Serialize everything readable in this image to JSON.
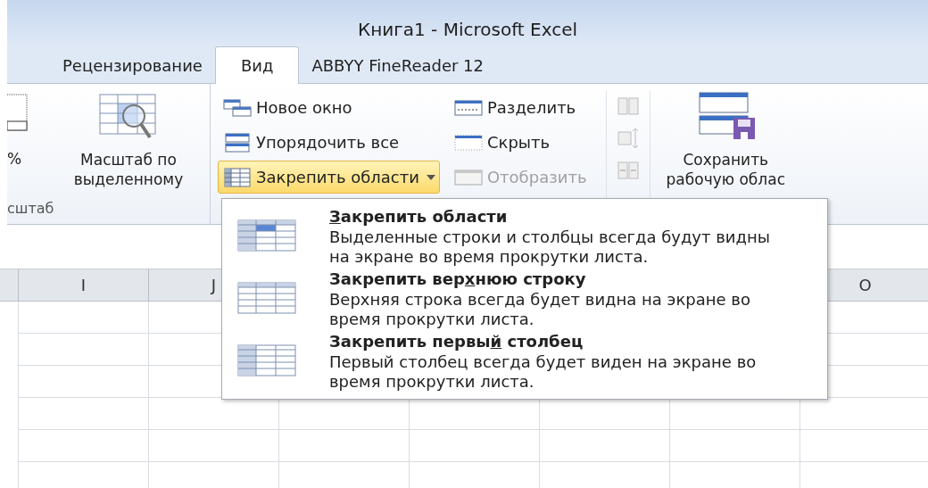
{
  "window": {
    "title": "Книга1  -  Microsoft Excel"
  },
  "tabs": [
    {
      "label": "Рецензирование",
      "selected": false
    },
    {
      "label": "Вид",
      "selected": true
    },
    {
      "label": "ABBYY FineReader 12",
      "selected": false
    }
  ],
  "ribbon": {
    "zoom_group": {
      "percent_label": "%",
      "zoom_selection": "Масштаб по выделенному",
      "group_label": "сштаб"
    },
    "window_group": {
      "left": [
        {
          "label": "Новое окно",
          "kind": "new-window",
          "disabled": false,
          "open": false
        },
        {
          "label": "Упорядочить все",
          "kind": "arrange",
          "disabled": false,
          "open": false
        },
        {
          "label": "Закрепить области",
          "kind": "freeze",
          "disabled": false,
          "open": true
        }
      ],
      "right": [
        {
          "label": "Разделить",
          "kind": "split",
          "disabled": false
        },
        {
          "label": "Скрыть",
          "kind": "hide",
          "disabled": false
        },
        {
          "label": "Отобразить",
          "kind": "unhide",
          "disabled": true
        }
      ]
    },
    "save_workspace": {
      "line_1": "Сохранить",
      "line_2": "рабочую облас"
    }
  },
  "freeze_menu": [
    {
      "kind": "panes",
      "mnemonic": "З",
      "title_after": "акрепить области",
      "description": "Выделенные строки и столбцы всегда будут видны на экране во время прокрутки листа."
    },
    {
      "kind": "top-row",
      "title_before": "Закрепить вер",
      "mnemonic": "х",
      "title_after": "нюю строку",
      "description": "Верхняя строка всегда будет видна на экране во время прокрутки листа."
    },
    {
      "kind": "first-column",
      "title_before": "Закрепить первы",
      "mnemonic": "й",
      "title_after": " столбец",
      "description": "Первый столбец всегда будет виден на экране во время прокрутки листа."
    }
  ],
  "sheet": {
    "columns": [
      {
        "label": "I"
      },
      {
        "label": "J"
      },
      {
        "label": "O"
      }
    ]
  }
}
